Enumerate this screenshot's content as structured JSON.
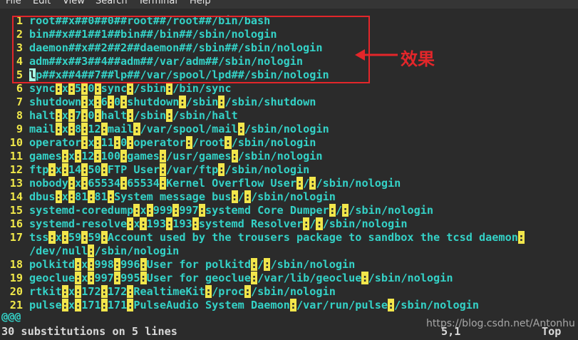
{
  "menubar": {
    "items": [
      "File",
      "Edit",
      "View",
      "Search",
      "Terminal",
      "Help"
    ]
  },
  "lines": [
    {
      "n": "1",
      "segs": [
        {
          "t": "root##x##0##0##root##/root##/bin/bash"
        }
      ]
    },
    {
      "n": "2",
      "segs": [
        {
          "t": "bin##x##1##1##bin##/bin##/sbin/nologin"
        }
      ]
    },
    {
      "n": "3",
      "segs": [
        {
          "t": "daemon##x##2##2##daemon##/sbin##/sbin/nologin"
        }
      ]
    },
    {
      "n": "4",
      "segs": [
        {
          "t": "adm##x##3##4##adm##/var/adm##/sbin/nologin"
        }
      ]
    },
    {
      "n": "5",
      "segs": [
        {
          "t": "l",
          "c": true
        },
        {
          "t": "p##x##4##7##lp##/var/spool/lpd##/sbin/nologin"
        }
      ]
    },
    {
      "n": "6",
      "segs": [
        {
          "t": "sync"
        },
        {
          "t": ":",
          "h": true
        },
        {
          "t": "x"
        },
        {
          "t": ":",
          "h": true
        },
        {
          "t": "5"
        },
        {
          "t": ":",
          "h": true
        },
        {
          "t": "0"
        },
        {
          "t": ":",
          "h": true
        },
        {
          "t": "sync"
        },
        {
          "t": ":",
          "h": true
        },
        {
          "t": "/sbin"
        },
        {
          "t": ":",
          "h": true
        },
        {
          "t": "/bin/sync"
        }
      ]
    },
    {
      "n": "7",
      "segs": [
        {
          "t": "shutdown"
        },
        {
          "t": ":",
          "h": true
        },
        {
          "t": "x"
        },
        {
          "t": ":",
          "h": true
        },
        {
          "t": "6"
        },
        {
          "t": ":",
          "h": true
        },
        {
          "t": "0"
        },
        {
          "t": ":",
          "h": true
        },
        {
          "t": "shutdown"
        },
        {
          "t": ":",
          "h": true
        },
        {
          "t": "/sbin"
        },
        {
          "t": ":",
          "h": true
        },
        {
          "t": "/sbin/shutdown"
        }
      ]
    },
    {
      "n": "8",
      "segs": [
        {
          "t": "halt"
        },
        {
          "t": ":",
          "h": true
        },
        {
          "t": "x"
        },
        {
          "t": ":",
          "h": true
        },
        {
          "t": "7"
        },
        {
          "t": ":",
          "h": true
        },
        {
          "t": "0"
        },
        {
          "t": ":",
          "h": true
        },
        {
          "t": "halt"
        },
        {
          "t": ":",
          "h": true
        },
        {
          "t": "/sbin"
        },
        {
          "t": ":",
          "h": true
        },
        {
          "t": "/sbin/halt"
        }
      ]
    },
    {
      "n": "9",
      "segs": [
        {
          "t": "mail"
        },
        {
          "t": ":",
          "h": true
        },
        {
          "t": "x"
        },
        {
          "t": ":",
          "h": true
        },
        {
          "t": "8"
        },
        {
          "t": ":",
          "h": true
        },
        {
          "t": "12"
        },
        {
          "t": ":",
          "h": true
        },
        {
          "t": "mail"
        },
        {
          "t": ":",
          "h": true
        },
        {
          "t": "/var/spool/mail"
        },
        {
          "t": ":",
          "h": true
        },
        {
          "t": "/sbin/nologin"
        }
      ]
    },
    {
      "n": "10",
      "segs": [
        {
          "t": "operator"
        },
        {
          "t": ":",
          "h": true
        },
        {
          "t": "x"
        },
        {
          "t": ":",
          "h": true
        },
        {
          "t": "11"
        },
        {
          "t": ":",
          "h": true
        },
        {
          "t": "0"
        },
        {
          "t": ":",
          "h": true
        },
        {
          "t": "operator"
        },
        {
          "t": ":",
          "h": true
        },
        {
          "t": "/root"
        },
        {
          "t": ":",
          "h": true
        },
        {
          "t": "/sbin/nologin"
        }
      ]
    },
    {
      "n": "11",
      "segs": [
        {
          "t": "games"
        },
        {
          "t": ":",
          "h": true
        },
        {
          "t": "x"
        },
        {
          "t": ":",
          "h": true
        },
        {
          "t": "12"
        },
        {
          "t": ":",
          "h": true
        },
        {
          "t": "100"
        },
        {
          "t": ":",
          "h": true
        },
        {
          "t": "games"
        },
        {
          "t": ":",
          "h": true
        },
        {
          "t": "/usr/games"
        },
        {
          "t": ":",
          "h": true
        },
        {
          "t": "/sbin/nologin"
        }
      ]
    },
    {
      "n": "12",
      "segs": [
        {
          "t": "ftp"
        },
        {
          "t": ":",
          "h": true
        },
        {
          "t": "x"
        },
        {
          "t": ":",
          "h": true
        },
        {
          "t": "14"
        },
        {
          "t": ":",
          "h": true
        },
        {
          "t": "50"
        },
        {
          "t": ":",
          "h": true
        },
        {
          "t": "FTP User"
        },
        {
          "t": ":",
          "h": true
        },
        {
          "t": "/var/ftp"
        },
        {
          "t": ":",
          "h": true
        },
        {
          "t": "/sbin/nologin"
        }
      ]
    },
    {
      "n": "13",
      "segs": [
        {
          "t": "nobody"
        },
        {
          "t": ":",
          "h": true
        },
        {
          "t": "x"
        },
        {
          "t": ":",
          "h": true
        },
        {
          "t": "65534"
        },
        {
          "t": ":",
          "h": true
        },
        {
          "t": "65534"
        },
        {
          "t": ":",
          "h": true
        },
        {
          "t": "Kernel Overflow User"
        },
        {
          "t": ":",
          "h": true
        },
        {
          "t": "/"
        },
        {
          "t": ":",
          "h": true
        },
        {
          "t": "/sbin/nologin"
        }
      ]
    },
    {
      "n": "14",
      "segs": [
        {
          "t": "dbus"
        },
        {
          "t": ":",
          "h": true
        },
        {
          "t": "x"
        },
        {
          "t": ":",
          "h": true
        },
        {
          "t": "81"
        },
        {
          "t": ":",
          "h": true
        },
        {
          "t": "81"
        },
        {
          "t": ":",
          "h": true
        },
        {
          "t": "System message bus"
        },
        {
          "t": ":",
          "h": true
        },
        {
          "t": "/"
        },
        {
          "t": ":",
          "h": true
        },
        {
          "t": "/sbin/nologin"
        }
      ]
    },
    {
      "n": "15",
      "segs": [
        {
          "t": "systemd-coredump"
        },
        {
          "t": ":",
          "h": true
        },
        {
          "t": "x"
        },
        {
          "t": ":",
          "h": true
        },
        {
          "t": "999"
        },
        {
          "t": ":",
          "h": true
        },
        {
          "t": "997"
        },
        {
          "t": ":",
          "h": true
        },
        {
          "t": "systemd Core Dumper"
        },
        {
          "t": ":",
          "h": true
        },
        {
          "t": "/"
        },
        {
          "t": ":",
          "h": true
        },
        {
          "t": "/sbin/nologin"
        }
      ]
    },
    {
      "n": "16",
      "segs": [
        {
          "t": "systemd-resolve"
        },
        {
          "t": ":",
          "h": true
        },
        {
          "t": "x"
        },
        {
          "t": ":",
          "h": true
        },
        {
          "t": "193"
        },
        {
          "t": ":",
          "h": true
        },
        {
          "t": "193"
        },
        {
          "t": ":",
          "h": true
        },
        {
          "t": "systemd Resolver"
        },
        {
          "t": ":",
          "h": true
        },
        {
          "t": "/"
        },
        {
          "t": ":",
          "h": true
        },
        {
          "t": "/sbin/nologin"
        }
      ]
    },
    {
      "n": "17",
      "segs": [
        {
          "t": "tss"
        },
        {
          "t": ":",
          "h": true
        },
        {
          "t": "x"
        },
        {
          "t": ":",
          "h": true
        },
        {
          "t": "59"
        },
        {
          "t": ":",
          "h": true
        },
        {
          "t": "59"
        },
        {
          "t": ":",
          "h": true
        },
        {
          "t": "Account used by the trousers package to sandbox the tcsd daemon"
        },
        {
          "t": ":",
          "h": true
        }
      ]
    },
    {
      "n": "",
      "segs": [
        {
          "t": "/dev/null"
        },
        {
          "t": ":",
          "h": true
        },
        {
          "t": "/sbin/nologin"
        }
      ]
    },
    {
      "n": "18",
      "segs": [
        {
          "t": "polkitd"
        },
        {
          "t": ":",
          "h": true
        },
        {
          "t": "x"
        },
        {
          "t": ":",
          "h": true
        },
        {
          "t": "998"
        },
        {
          "t": ":",
          "h": true
        },
        {
          "t": "996"
        },
        {
          "t": ":",
          "h": true
        },
        {
          "t": "User for polkitd"
        },
        {
          "t": ":",
          "h": true
        },
        {
          "t": "/"
        },
        {
          "t": ":",
          "h": true
        },
        {
          "t": "/sbin/nologin"
        }
      ]
    },
    {
      "n": "19",
      "segs": [
        {
          "t": "geoclue"
        },
        {
          "t": ":",
          "h": true
        },
        {
          "t": "x"
        },
        {
          "t": ":",
          "h": true
        },
        {
          "t": "997"
        },
        {
          "t": ":",
          "h": true
        },
        {
          "t": "995"
        },
        {
          "t": ":",
          "h": true
        },
        {
          "t": "User for geoclue"
        },
        {
          "t": ":",
          "h": true
        },
        {
          "t": "/var/lib/geoclue"
        },
        {
          "t": ":",
          "h": true
        },
        {
          "t": "/sbin/nologin"
        }
      ]
    },
    {
      "n": "20",
      "segs": [
        {
          "t": "rtkit"
        },
        {
          "t": ":",
          "h": true
        },
        {
          "t": "x"
        },
        {
          "t": ":",
          "h": true
        },
        {
          "t": "172"
        },
        {
          "t": ":",
          "h": true
        },
        {
          "t": "172"
        },
        {
          "t": ":",
          "h": true
        },
        {
          "t": "RealtimeKit"
        },
        {
          "t": ":",
          "h": true
        },
        {
          "t": "/proc"
        },
        {
          "t": ":",
          "h": true
        },
        {
          "t": "/sbin/nologin"
        }
      ]
    },
    {
      "n": "21",
      "segs": [
        {
          "t": "pulse"
        },
        {
          "t": ":",
          "h": true
        },
        {
          "t": "x"
        },
        {
          "t": ":",
          "h": true
        },
        {
          "t": "171"
        },
        {
          "t": ":",
          "h": true
        },
        {
          "t": "171"
        },
        {
          "t": ":",
          "h": true
        },
        {
          "t": "PulseAudio System Daemon"
        },
        {
          "t": ":",
          "h": true
        },
        {
          "t": "/var/run/pulse"
        },
        {
          "t": ":",
          "h": true
        },
        {
          "t": "/sbin/nologin"
        }
      ]
    }
  ],
  "continuation_marker": "@@@",
  "status": {
    "message": "30 substitutions on 5 lines",
    "position": "5,1",
    "scroll": "Top"
  },
  "annotation": {
    "label": "效果",
    "color": "#e3262a"
  },
  "watermark": "https://blog.csdn.net/Antonhu",
  "colors": {
    "background": "#2b2b2b",
    "text": "#34d2c7",
    "line_number": "#f0e84a",
    "search_highlight": "#f2e64b"
  }
}
